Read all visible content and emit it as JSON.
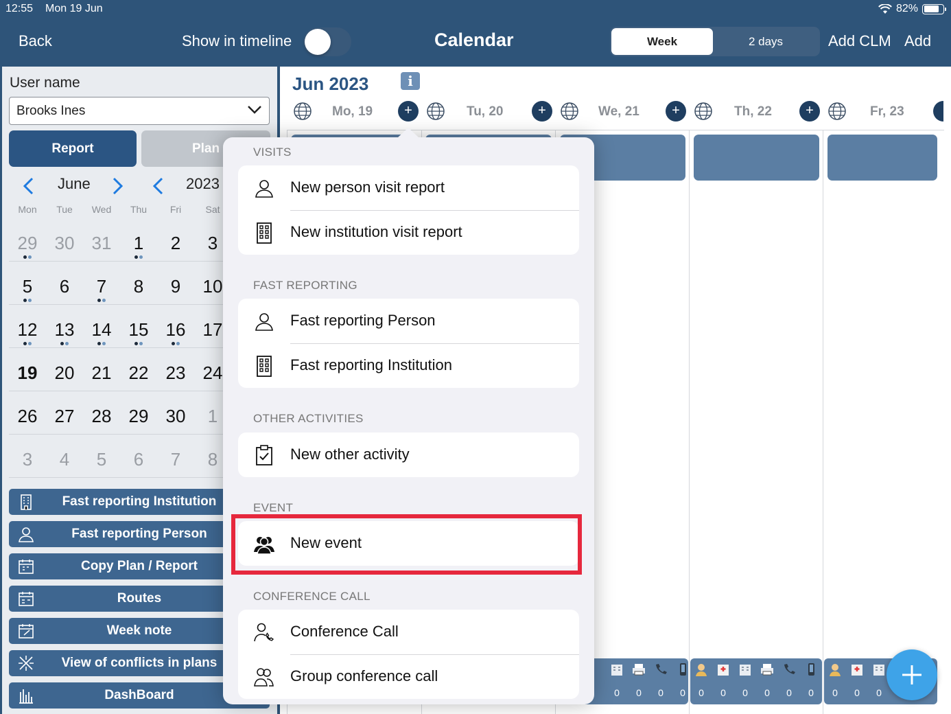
{
  "status": {
    "time": "12:55",
    "date": "Mon 19 Jun",
    "battery": "82%"
  },
  "nav": {
    "back": "Back",
    "show_timeline": "Show in timeline",
    "title": "Calendar",
    "week": "Week",
    "two_days": "2 days",
    "add_clm": "Add CLM",
    "add": "Add"
  },
  "sidebar": {
    "user_label": "User name",
    "user_value": "Brooks Ines",
    "report": "Report",
    "plan": "Plan",
    "month": "June",
    "year": "2023",
    "weekdays": [
      "Mon",
      "Tue",
      "Wed",
      "Thu",
      "Fri",
      "Sat"
    ],
    "weeks": [
      [
        "29",
        "30",
        "31",
        "1",
        "2",
        "3"
      ],
      [
        "5",
        "6",
        "7",
        "8",
        "9",
        "10"
      ],
      [
        "12",
        "13",
        "14",
        "15",
        "16",
        "17"
      ],
      [
        "19",
        "20",
        "21",
        "22",
        "23",
        "24"
      ],
      [
        "26",
        "27",
        "28",
        "29",
        "30",
        "1"
      ],
      [
        "3",
        "4",
        "5",
        "6",
        "7",
        "8"
      ]
    ],
    "buttons": [
      {
        "label": "Fast reporting  Institution",
        "icon": "building-icon"
      },
      {
        "label": "Fast reporting  Person",
        "icon": "person-icon"
      },
      {
        "label": "Copy Plan / Report",
        "icon": "calendar-copy-icon"
      },
      {
        "label": "Routes",
        "icon": "calendar-routes-icon"
      },
      {
        "label": "Week note",
        "icon": "calendar-note-icon"
      },
      {
        "label": "View of conflicts in plans",
        "icon": "conflict-icon"
      },
      {
        "label": "DashBoard",
        "icon": "dashboard-icon"
      }
    ]
  },
  "calendar": {
    "month_title": "Jun 2023",
    "info": "i",
    "days": [
      "Mo, 19",
      "Tu, 20",
      "We, 21",
      "Th, 22",
      "Fr, 23"
    ],
    "stat_value": "0"
  },
  "popover": {
    "visits_header": "VISITS",
    "new_person_visit": "New person visit report",
    "new_institution_visit": "New institution visit report",
    "fast_header": "FAST REPORTING",
    "fast_person": "Fast reporting  Person",
    "fast_institution": "Fast reporting  Institution",
    "other_header": "OTHER ACTIVITIES",
    "new_other": "New other activity",
    "event_header": "EVENT",
    "new_event": "New event",
    "conf_header": "CONFERENCE CALL",
    "conference_call": "Conference Call",
    "group_call": "Group conference call"
  },
  "colors": {
    "nav": "#2e5479",
    "accent": "#2b5583",
    "fab": "#3ea3e8",
    "highlight": "#e6283d"
  }
}
